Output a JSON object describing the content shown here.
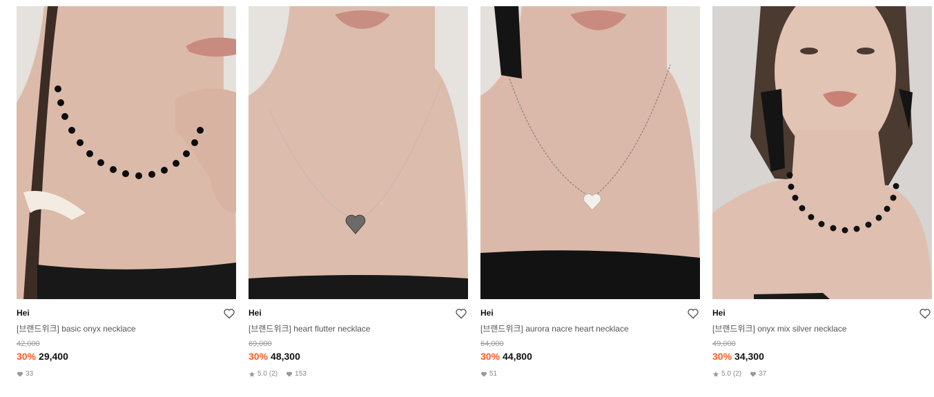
{
  "products": [
    {
      "brand": "Hei",
      "name": "[브랜드위크] basic onyx necklace",
      "original_price": "42,000",
      "discount": "30%",
      "price": "29,400",
      "rating": "",
      "reviews": "",
      "likes": "33",
      "necklace": "onyx-beads",
      "top_color": "#1a1a1a",
      "skin_color": "#d9b7a6"
    },
    {
      "brand": "Hei",
      "name": "[브랜드위크] heart flutter necklace",
      "original_price": "69,000",
      "discount": "30%",
      "price": "48,300",
      "rating": "5.0",
      "reviews": "(2)",
      "likes": "153",
      "necklace": "silver-heart",
      "top_color": "#1a1a1a",
      "skin_color": "#dcbcad"
    },
    {
      "brand": "Hei",
      "name": "[브랜드위크] aurora nacre heart necklace",
      "original_price": "64,000",
      "discount": "30%",
      "price": "44,800",
      "rating": "",
      "reviews": "",
      "likes": "51",
      "necklace": "nacre-heart",
      "top_color": "#121212",
      "skin_color": "#dbb9aa"
    },
    {
      "brand": "Hei",
      "name": "[브랜드위크] onyx mix silver necklace",
      "original_price": "49,000",
      "discount": "30%",
      "price": "34,300",
      "rating": "5.0",
      "reviews": "(2)",
      "likes": "37",
      "necklace": "onyx-mix",
      "top_color": "#1a1a1a",
      "skin_color": "#dfc0b0"
    }
  ],
  "colors": {
    "discount": "#ff5a1f",
    "brand_text": "#111111",
    "name_text": "#555555",
    "muted": "#999999"
  },
  "icons": {
    "wishlist": "heart-outline-icon",
    "rating": "star-icon",
    "likes": "heart-filled-icon"
  }
}
